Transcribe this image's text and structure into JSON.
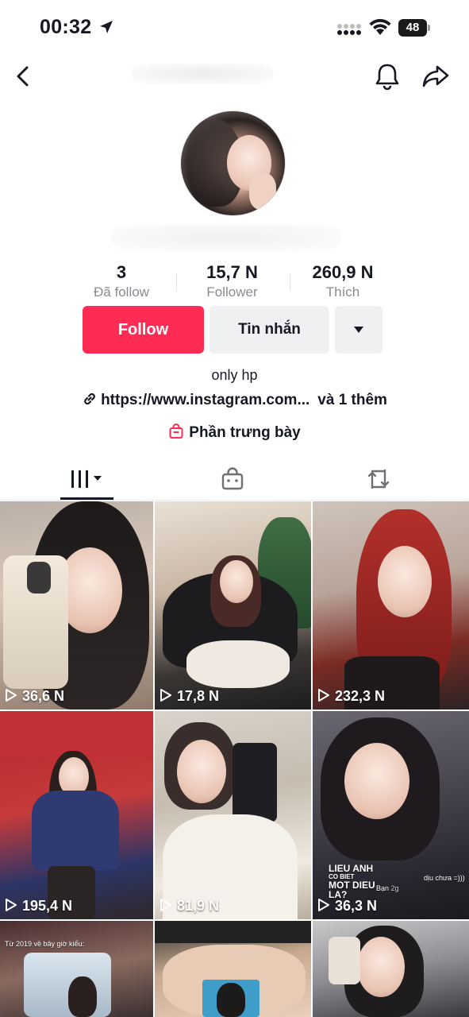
{
  "status_bar": {
    "time": "00:32",
    "battery": "48"
  },
  "profile": {
    "stats": [
      {
        "value": "3",
        "label": "Đã follow"
      },
      {
        "value": "15,7 N",
        "label": "Follower"
      },
      {
        "value": "260,9 N",
        "label": "Thích"
      }
    ],
    "buttons": {
      "follow": "Follow",
      "message": "Tin nhắn"
    },
    "bio": "only hp",
    "link": {
      "url": "https://www.instagram.com...",
      "more": "và 1 thêm"
    },
    "showcase": "Phần trưng bày"
  },
  "tabs": [
    {
      "icon": "videos-grid-icon",
      "active": true
    },
    {
      "icon": "shop-bag-icon",
      "active": false
    },
    {
      "icon": "repost-icon",
      "active": false
    }
  ],
  "videos": [
    {
      "views": "36,6 N"
    },
    {
      "views": "17,8 N"
    },
    {
      "views": "232,3 N"
    },
    {
      "views": "195,4 N"
    },
    {
      "views": "81,9 N"
    },
    {
      "views": "36,3 N",
      "overlay_lines": [
        "LIEU ANH",
        "CO BIET",
        "MOT DIEU",
        "LA?"
      ],
      "overlay_small": "dịu chưa =)))",
      "overlay_comment": "Bạn",
      "overlay_time": "2g"
    },
    {
      "overlay_small": "Từ 2019 về bây giờ kiểu:"
    },
    {},
    {}
  ],
  "colors": {
    "accent": "#fe2c55",
    "secondary_button": "#eff0f1",
    "muted_text": "#8a8b91",
    "text": "#161823"
  }
}
